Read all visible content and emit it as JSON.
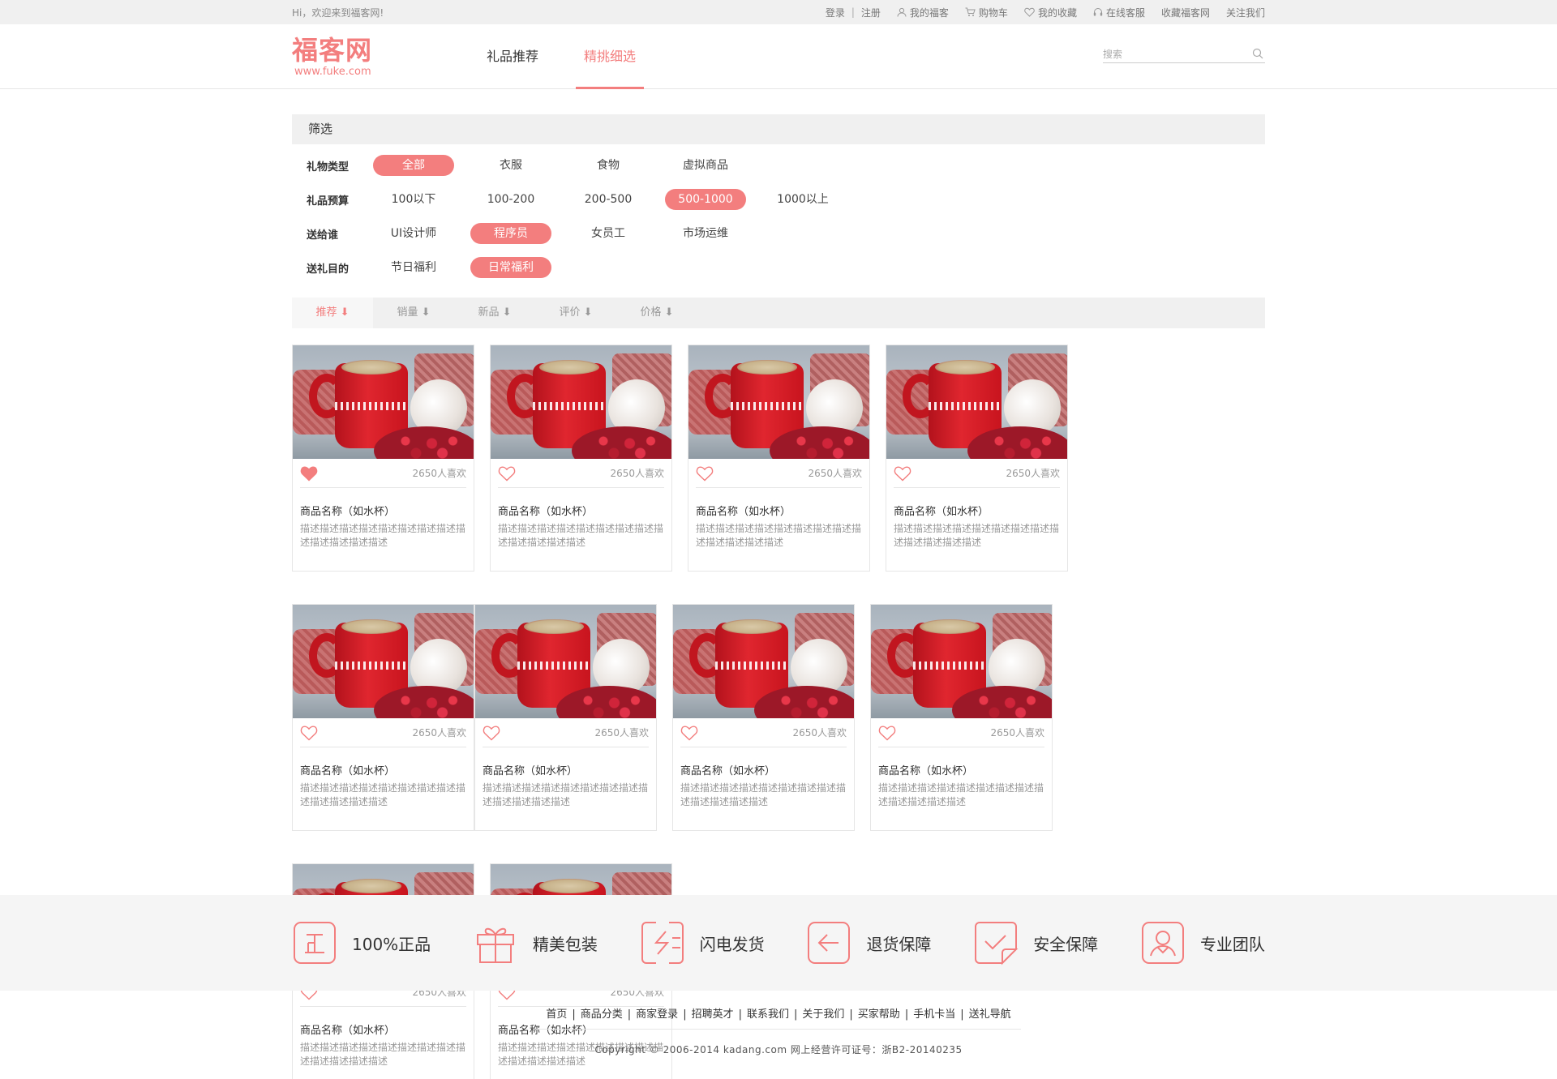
{
  "topbar": {
    "welcome": "Hi，欢迎来到福客网!",
    "login": "登录",
    "register": "注册",
    "my_fuke": "我的福客",
    "cart": "购物车",
    "favorites": "我的收藏",
    "online_service": "在线客服",
    "bookmark": "收藏福客网",
    "follow": "关注我们"
  },
  "header": {
    "logo_title": "福客网",
    "logo_url": "www.fuke.com",
    "nav": [
      {
        "label": "礼品推荐",
        "active": false
      },
      {
        "label": "精挑细选",
        "active": true
      }
    ],
    "search_placeholder": "搜索"
  },
  "filter": {
    "title": "筛选",
    "rows": [
      {
        "label": "礼物类型",
        "options": [
          "全部",
          "衣服",
          "食物",
          "虚拟商品"
        ],
        "selected": "全部"
      },
      {
        "label": "礼品预算",
        "options": [
          "100以下",
          "100-200",
          "200-500",
          "500-1000",
          "1000以上"
        ],
        "selected": "500-1000"
      },
      {
        "label": "送给谁",
        "options": [
          "UI设计师",
          "程序员",
          "女员工",
          "市场运维"
        ],
        "selected": "程序员"
      },
      {
        "label": "送礼目的",
        "options": [
          "节日福利",
          "日常福利"
        ],
        "selected": "日常福利"
      }
    ]
  },
  "sort": {
    "items": [
      {
        "label": "推荐 ⬇",
        "active": true
      },
      {
        "label": "销量 ⬇",
        "active": false
      },
      {
        "label": "新品 ⬇",
        "active": false
      },
      {
        "label": "评价 ⬇",
        "active": false
      },
      {
        "label": "价格 ⬇",
        "active": false
      }
    ]
  },
  "products": [
    {
      "name": "商品名称（如水杯）",
      "likes": "2650人喜欢",
      "desc": "描述描述描述描述描述描述描述描述描述描述描述描述描述",
      "liked": true
    },
    {
      "name": "商品名称（如水杯）",
      "likes": "2650人喜欢",
      "desc": "描述描述描述描述描述描述描述描述描述描述描述描述描述",
      "liked": false
    },
    {
      "name": "商品名称（如水杯）",
      "likes": "2650人喜欢",
      "desc": "描述描述描述描述描述描述描述描述描述描述描述描述描述",
      "liked": false
    },
    {
      "name": "商品名称（如水杯）",
      "likes": "2650人喜欢",
      "desc": "描述描述描述描述描述描述描述描述描述描述描述描述描述",
      "liked": false
    },
    {
      "name": "商品名称（如水杯）",
      "likes": "2650人喜欢",
      "desc": "描述描述描述描述描述描述描述描述描述描述描述描述描述",
      "liked": false
    },
    {
      "name": "商品名称（如水杯）",
      "likes": "2650人喜欢",
      "desc": "描述描述描述描述描述描述描述描述描述描述描述描述描述",
      "liked": false
    },
    {
      "name": "商品名称（如水杯）",
      "likes": "2650人喜欢",
      "desc": "描述描述描述描述描述描述描述描述描述描述描述描述描述",
      "liked": false
    },
    {
      "name": "商品名称（如水杯）",
      "likes": "2650人喜欢",
      "desc": "描述描述描述描述描述描述描述描述描述描述描述描述描述",
      "liked": false
    },
    {
      "name": "商品名称（如水杯）",
      "likes": "2650人喜欢",
      "desc": "描述描述描述描述描述描述描述描述描述描述描述描述描述",
      "liked": false
    },
    {
      "name": "商品名称（如水杯）",
      "likes": "2650人喜欢",
      "desc": "描述描述描述描述描述描述描述描述描述描述描述描述描述",
      "liked": false
    }
  ],
  "services": [
    {
      "label": "100%正品",
      "icon": "genuine-icon"
    },
    {
      "label": "精美包装",
      "icon": "gift-icon"
    },
    {
      "label": "闪电发货",
      "icon": "lightning-icon"
    },
    {
      "label": "退货保障",
      "icon": "return-icon"
    },
    {
      "label": "安全保障",
      "icon": "safe-check-icon"
    },
    {
      "label": "专业团队",
      "icon": "team-icon"
    }
  ],
  "footer": {
    "links": [
      "首页",
      "商品分类",
      "商家登录",
      "招聘英才",
      "联系我们",
      "关于我们",
      "买家帮助",
      "手机卡当",
      "送礼导航"
    ],
    "copyright": "Copyright © 2006-2014 kadang.com 网上经营许可证号：浙B2-20140235"
  },
  "colors": {
    "accent": "#f37e7e",
    "bar_bg": "#f0f0f0",
    "band_bg": "#f5f5f5"
  }
}
